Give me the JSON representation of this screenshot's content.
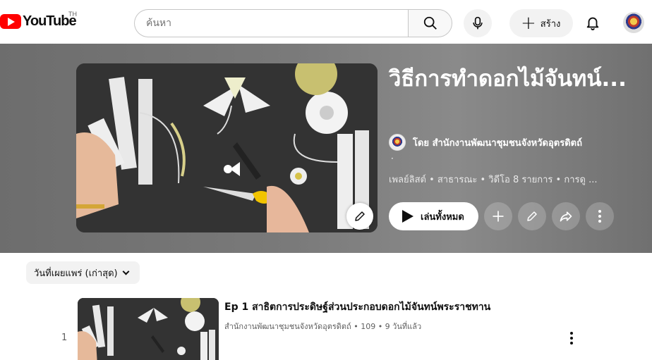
{
  "topbar": {
    "logo_text": "YouTube",
    "country_code": "TH",
    "search_placeholder": "ค้นหา",
    "create_label": "สร้าง",
    "icons": [
      "search-icon",
      "microphone-icon",
      "plus-icon",
      "bell-icon"
    ]
  },
  "playlist": {
    "title": "วิธีการทำดอกไม้จันทน์...",
    "owner": "โดย สำนักงานพัฒนาชุมชนจังหวัดอุตรดิตถ์",
    "dot": "·",
    "meta": "เพลย์ลิสต์ • สาธารณะ • วิดีโอ 8 รายการ • การดู ...",
    "play_all_label": "เล่นทั้งหมด"
  },
  "sort": {
    "label": "วันที่เผยแพร่ (เก่าสุด)"
  },
  "videos": [
    {
      "index": "1",
      "title": "Ep 1 สาธิตการประดิษฐ์ส่วนประกอบดอกไม้จันทน์พระราชทาน",
      "meta": "สำนักงานพัฒนาชุมชนจังหวัดอุตรดิตถ์ • 109 • 9 วันที่แล้ว"
    }
  ],
  "colors": {
    "brand_red": "#ff0000",
    "header_bg": "#7a7a7a",
    "text_primary": "#0f0f0f",
    "text_secondary": "#606060"
  }
}
